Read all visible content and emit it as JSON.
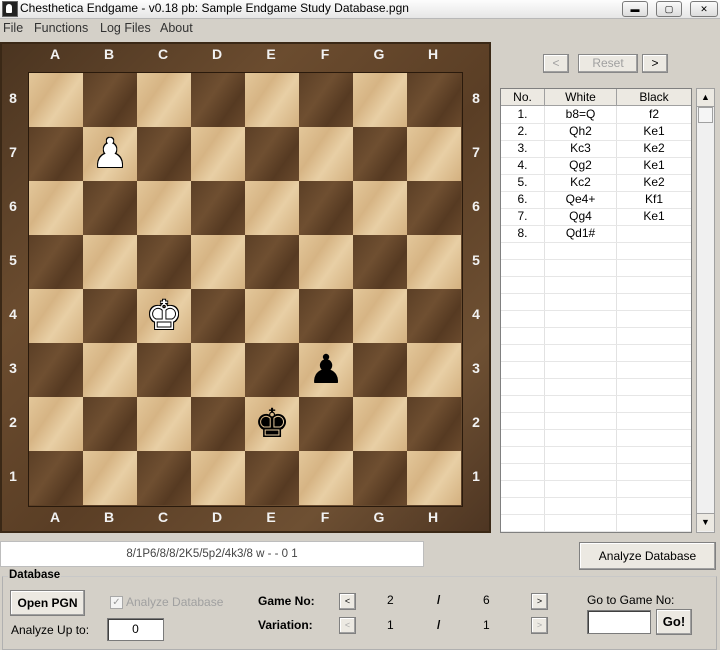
{
  "window": {
    "title": "Chesthetica Endgame - v0.18 pb:  Sample Endgame Study Database.pgn",
    "minimize_glyph": "▬",
    "maximize_glyph": "▢",
    "close_glyph": "✕"
  },
  "menu": {
    "items": [
      "File",
      "Functions",
      "Log Files",
      "About"
    ]
  },
  "board": {
    "files": [
      "A",
      "B",
      "C",
      "D",
      "E",
      "F",
      "G",
      "H"
    ],
    "ranks": [
      "8",
      "7",
      "6",
      "5",
      "4",
      "3",
      "2",
      "1"
    ],
    "pieces": [
      {
        "square": "b7",
        "color": "white",
        "type": "pawn",
        "glyph": "♟"
      },
      {
        "square": "c4",
        "color": "white",
        "type": "king",
        "glyph": "♚"
      },
      {
        "square": "f3",
        "color": "black",
        "type": "pawn",
        "glyph": "♟"
      },
      {
        "square": "e2",
        "color": "black",
        "type": "king",
        "glyph": "♚"
      }
    ],
    "light_color": "#dcbd8d",
    "dark_color": "#634529"
  },
  "navigation": {
    "prev_label": "<",
    "reset_label": "Reset",
    "next_label": ">"
  },
  "moves_table": {
    "headers": [
      "No.",
      "White",
      "Black"
    ],
    "rows": [
      {
        "no": "1.",
        "white": "b8=Q",
        "black": "f2"
      },
      {
        "no": "2.",
        "white": "Qh2",
        "black": "Ke1"
      },
      {
        "no": "3.",
        "white": "Kc3",
        "black": "Ke2"
      },
      {
        "no": "4.",
        "white": "Qg2",
        "black": "Ke1"
      },
      {
        "no": "5.",
        "white": "Kc2",
        "black": "Ke2"
      },
      {
        "no": "6.",
        "white": "Qe4+",
        "black": "Kf1"
      },
      {
        "no": "7.",
        "white": "Qg4",
        "black": "Ke1"
      },
      {
        "no": "8.",
        "white": "Qd1#",
        "black": ""
      }
    ],
    "scroll_up_glyph": "▲",
    "scroll_down_glyph": "▼"
  },
  "fen": "8/1P6/8/8/2K5/5p2/4k3/8 w - - 0 1",
  "analyze_database_button": "Analyze Database",
  "database": {
    "title": "Database",
    "open_pgn_label": "Open PGN",
    "analyze_checkbox_label": "Analyze Database",
    "analyze_checked": true,
    "analyze_up_to_label": "Analyze Up to:",
    "analyze_up_to_value": "0",
    "game_no_label": "Game No:",
    "game_current": "2",
    "game_separator": "/",
    "game_total": "6",
    "variation_label": "Variation:",
    "variation_current": "1",
    "variation_separator": "/",
    "variation_total": "1",
    "goto_label": "Go to Game No:",
    "goto_value": "",
    "go_button": "Go!",
    "left_glyph": "<",
    "right_glyph": ">"
  }
}
